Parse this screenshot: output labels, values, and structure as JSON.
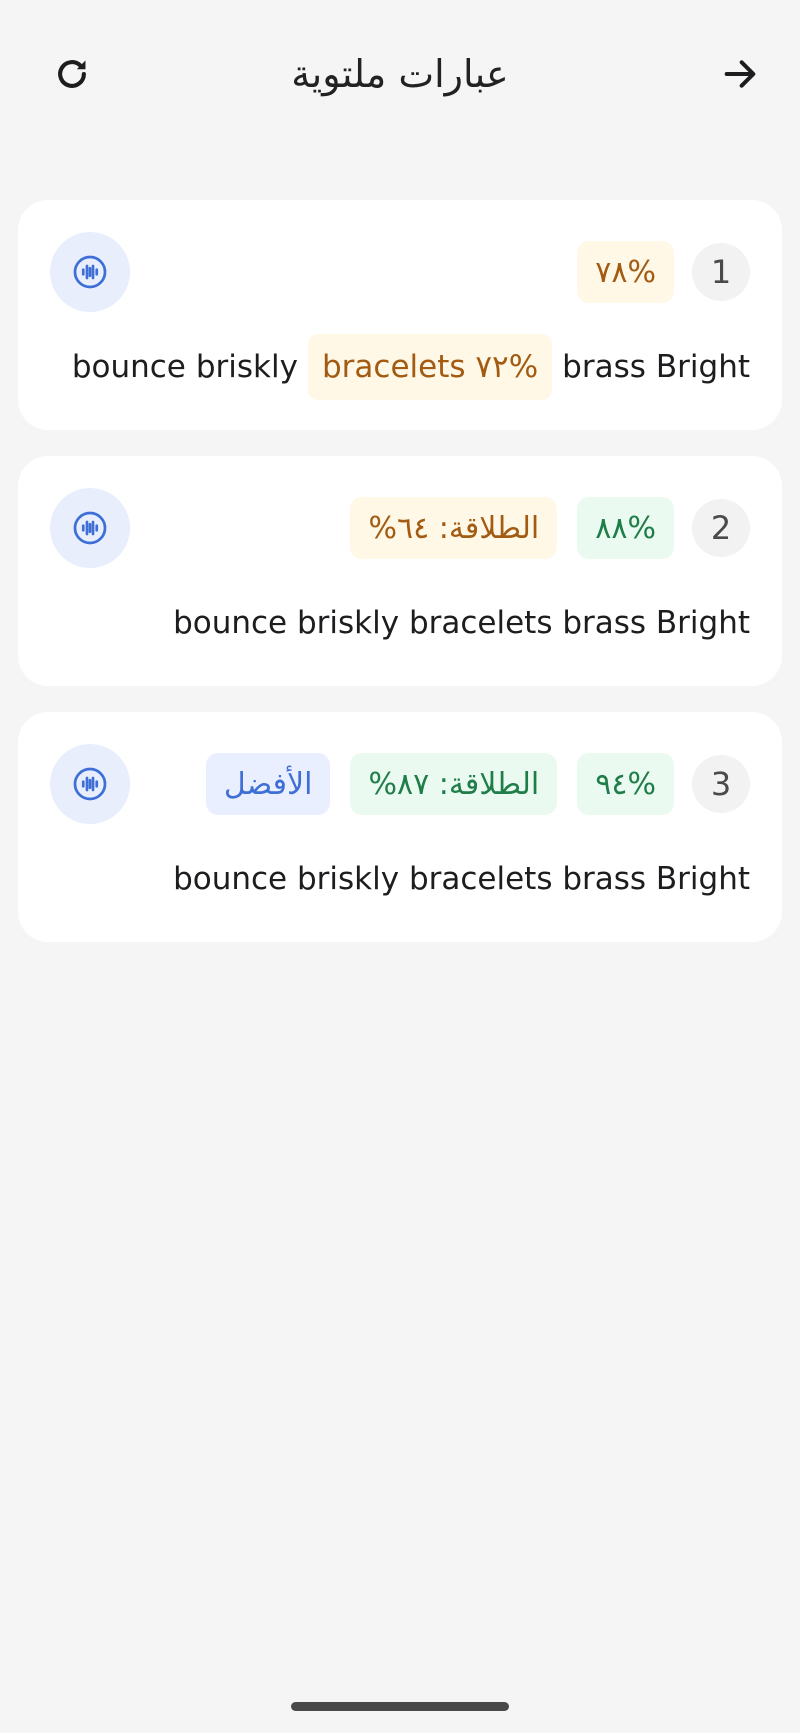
{
  "header": {
    "title": "عبارات ملتوية",
    "back_icon": "arrow-right-icon",
    "refresh_icon": "refresh-icon"
  },
  "colors": {
    "warn_bg": "#fff8e6",
    "warn_text": "#a35a12",
    "good_bg": "#eafaf0",
    "good_text": "#1e7d48",
    "best_bg": "#e9efff",
    "best_text": "#3d6fd6",
    "accent": "#3d6fd6"
  },
  "attempts": [
    {
      "number": "1",
      "score": "%٧٨",
      "sentence_words": [
        {
          "text": "Bright",
          "highlight": false
        },
        {
          "text": "brass",
          "highlight": false
        },
        {
          "text": "bracelets",
          "highlight": true,
          "score": "%٧٢"
        },
        {
          "text": "briskly",
          "highlight": false
        },
        {
          "text": "bounce",
          "highlight": false
        }
      ]
    },
    {
      "number": "2",
      "score": "%٨٨",
      "fluency": "الطلاقة: ٦٤%",
      "sentence": "bounce briskly bracelets brass Bright"
    },
    {
      "number": "3",
      "score": "%٩٤",
      "fluency": "الطلاقة: ٨٧%",
      "best_label": "الأفضل",
      "sentence": "bounce briskly bracelets brass Bright"
    }
  ]
}
